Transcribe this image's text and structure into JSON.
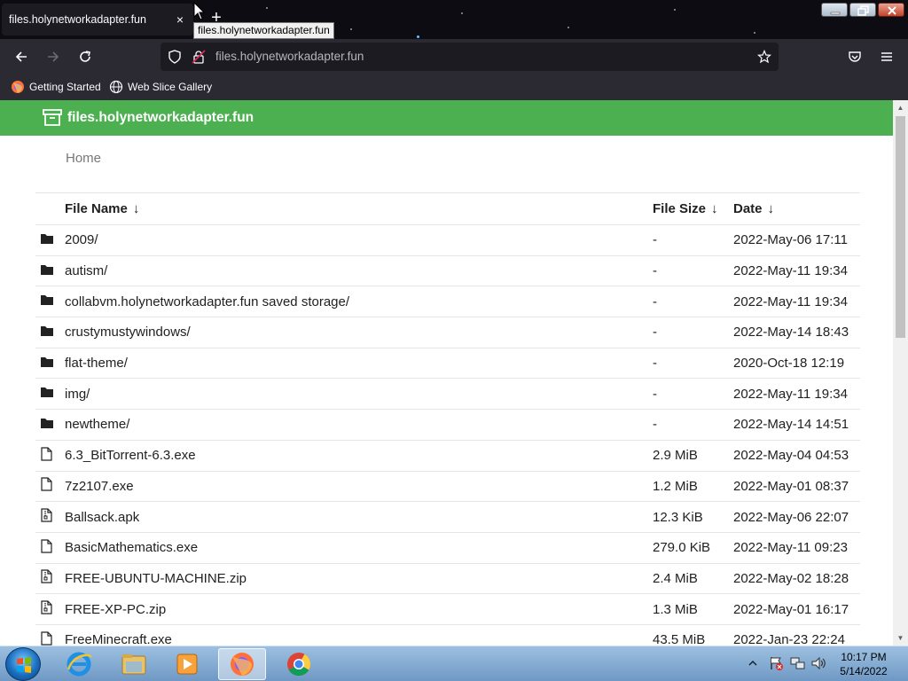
{
  "browser": {
    "tab_title": "files.holynetworkadapter.fun",
    "tab_close": "×",
    "new_tab": "+",
    "tooltip": "files.holynetworkadapter.fun",
    "url": "files.holynetworkadapter.fun",
    "bookmarks": [
      {
        "label": "Getting Started",
        "icon": "firefox-icon"
      },
      {
        "label": "Web Slice Gallery",
        "icon": "globe-icon"
      }
    ]
  },
  "site": {
    "title": "files.holynetworkadapter.fun",
    "header_color": "#4caf50",
    "breadcrumb": "Home"
  },
  "table": {
    "headers": {
      "name": "File Name",
      "size": "File Size",
      "date": "Date",
      "sort_arrow": "↓"
    },
    "rows": [
      {
        "type": "folder",
        "name": "2009/",
        "size": "-",
        "date": "2022-May-06 17:11"
      },
      {
        "type": "folder",
        "name": "autism/",
        "size": "-",
        "date": "2022-May-11 19:34"
      },
      {
        "type": "folder",
        "name": "collabvm.holynetworkadapter.fun saved storage/",
        "size": "-",
        "date": "2022-May-11 19:34"
      },
      {
        "type": "folder",
        "name": "crustymustywindows/",
        "size": "-",
        "date": "2022-May-14 18:43"
      },
      {
        "type": "folder",
        "name": "flat-theme/",
        "size": "-",
        "date": "2020-Oct-18 12:19"
      },
      {
        "type": "folder",
        "name": "img/",
        "size": "-",
        "date": "2022-May-11 19:34"
      },
      {
        "type": "folder",
        "name": "newtheme/",
        "size": "-",
        "date": "2022-May-14 14:51"
      },
      {
        "type": "file",
        "name": "6.3_BitTorrent-6.3.exe",
        "size": "2.9 MiB",
        "date": "2022-May-04 04:53"
      },
      {
        "type": "file",
        "name": "7z2107.exe",
        "size": "1.2 MiB",
        "date": "2022-May-01 08:37"
      },
      {
        "type": "archive",
        "name": "Ballsack.apk",
        "size": "12.3 KiB",
        "date": "2022-May-06 22:07"
      },
      {
        "type": "file",
        "name": "BasicMathematics.exe",
        "size": "279.0 KiB",
        "date": "2022-May-11 09:23"
      },
      {
        "type": "archive",
        "name": "FREE-UBUNTU-MACHINE.zip",
        "size": "2.4 MiB",
        "date": "2022-May-02 18:28"
      },
      {
        "type": "archive",
        "name": "FREE-XP-PC.zip",
        "size": "1.3 MiB",
        "date": "2022-May-01 16:17"
      },
      {
        "type": "file",
        "name": "FreeMinecraft.exe",
        "size": "43.5 MiB",
        "date": "2022-Jan-23 22:24"
      }
    ]
  },
  "taskbar": {
    "apps": [
      "internet-explorer-icon",
      "file-explorer-icon",
      "media-player-icon",
      "firefox-icon",
      "chrome-icon"
    ],
    "active_app": "firefox-icon",
    "clock_time": "10:17 PM",
    "clock_date": "5/14/2022"
  }
}
